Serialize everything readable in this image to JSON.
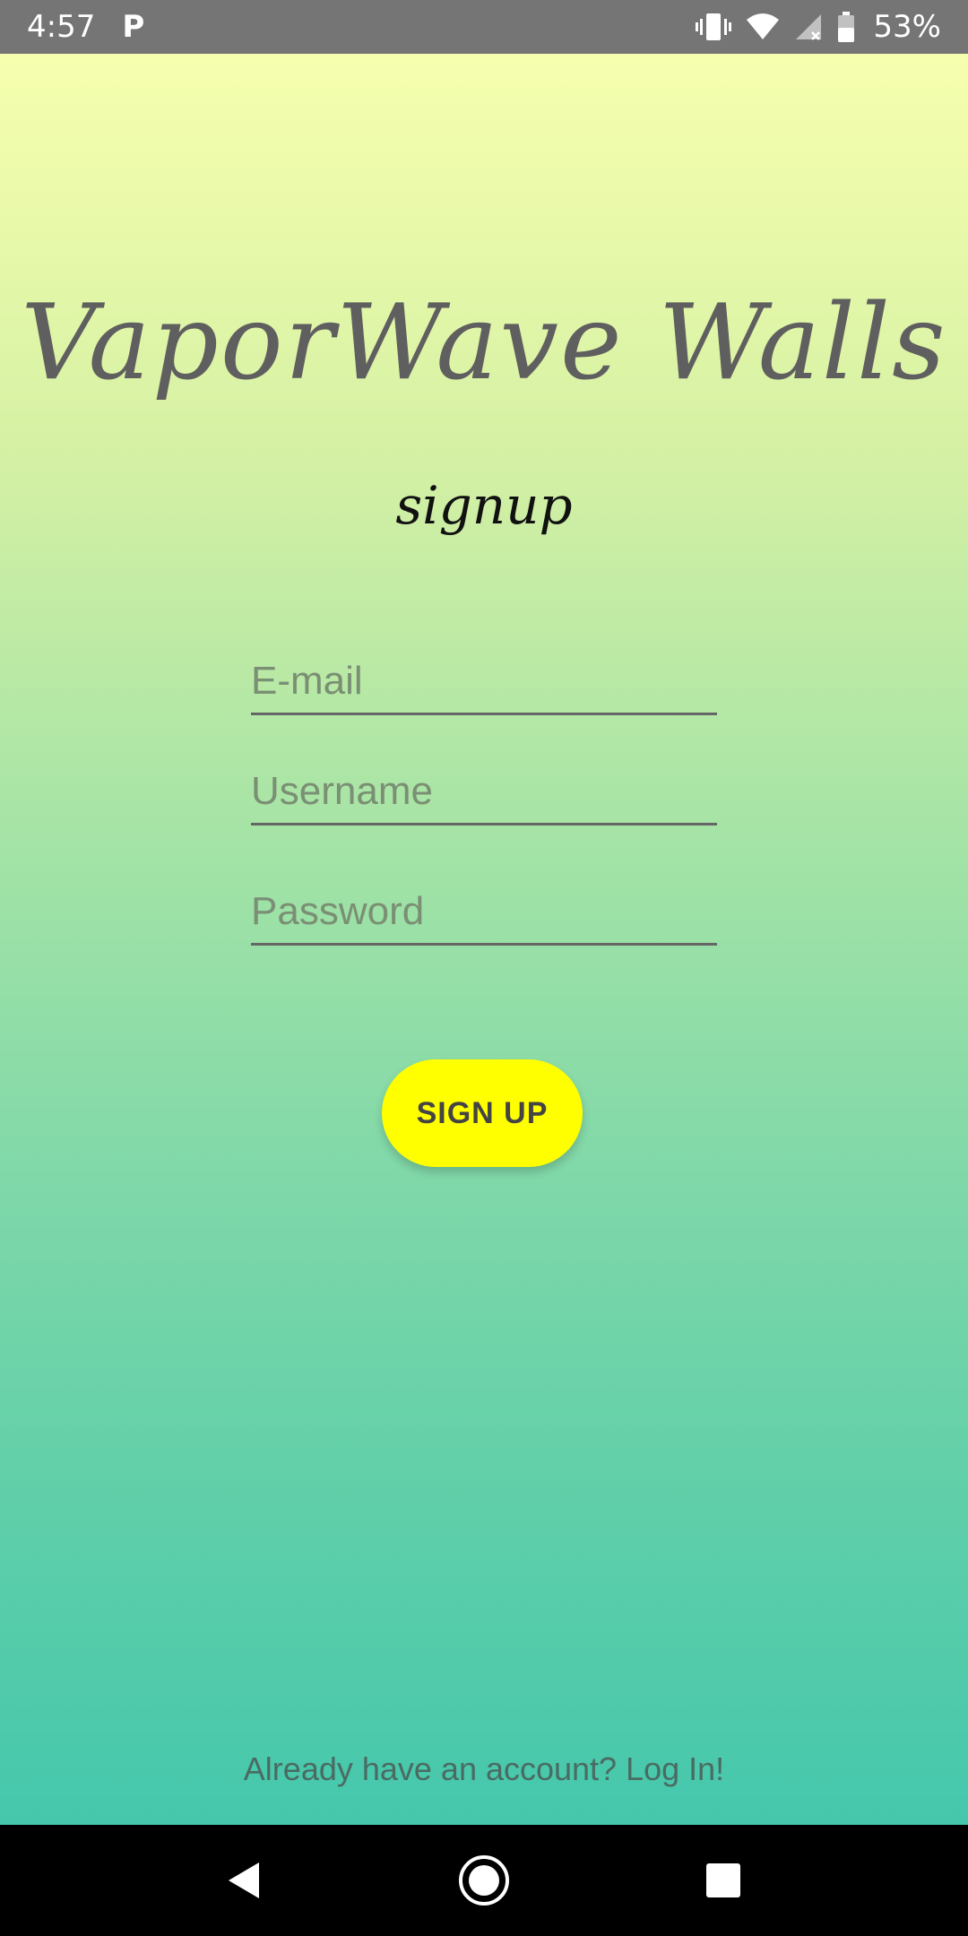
{
  "status_bar": {
    "time": "4:57",
    "notification_icon": "parking-p-icon",
    "icons": [
      "vibrate-icon",
      "wifi-icon",
      "cell-signal-icon",
      "battery-icon"
    ],
    "battery_percent": "53%"
  },
  "app": {
    "title": "VaporWave Walls",
    "subtitle": "signup"
  },
  "form": {
    "email_placeholder": "E-mail",
    "username_placeholder": "Username",
    "password_placeholder": "Password",
    "signup_label": "SIGN UP"
  },
  "footer": {
    "login_link": "Already have an account? Log In!"
  },
  "nav": {
    "icons": [
      "back-icon",
      "home-icon",
      "recents-icon"
    ]
  },
  "colors": {
    "gradient_top": "#f6ffae",
    "gradient_bottom": "#45c7ac",
    "button": "#ffff00",
    "status_bar": "#757575"
  }
}
